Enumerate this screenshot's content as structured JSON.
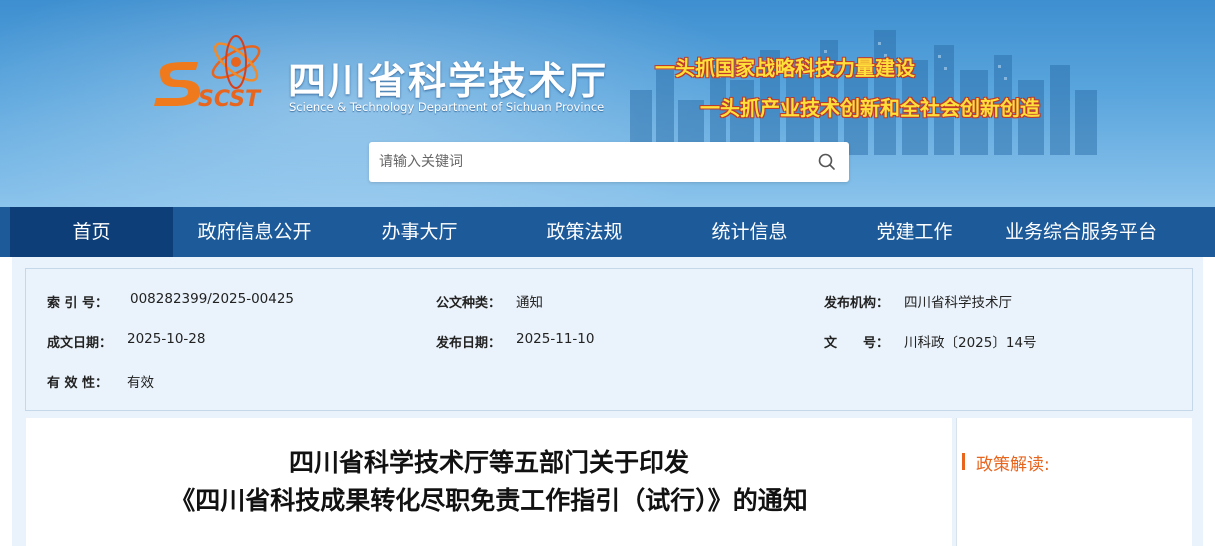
{
  "site": {
    "name": "四川省科学技术厅",
    "name_en": "Science & Technology Department of Sichuan Province",
    "logo_text": "SCST",
    "slogan_line1": "一头抓国家战略科技力量建设",
    "slogan_line2": "一头抓产业技术创新和全社会创新创造"
  },
  "search": {
    "placeholder": "请输入关键词",
    "value": ""
  },
  "nav": {
    "items": [
      {
        "label": "首页",
        "active": true
      },
      {
        "label": "政府信息公开"
      },
      {
        "label": "办事大厅"
      },
      {
        "label": "政策法规"
      },
      {
        "label": "统计信息"
      },
      {
        "label": "党建工作"
      },
      {
        "label": "业务综合服务平台"
      }
    ]
  },
  "meta": {
    "index_label": "索 引 号：",
    "index_value": "008282399/2025-00425",
    "type_label": "公文种类：",
    "type_value": "通知",
    "issuer_label": "发布机构：",
    "issuer_value": "四川省科学技术厅",
    "created_label": "成文日期：",
    "created_value": "2025-10-28",
    "published_label": "发布日期：",
    "published_value": "2025-11-10",
    "docno_label": "文　　号：",
    "docno_value": "川科政〔2025〕14号",
    "validity_label": "有 效 性：",
    "validity_value": "有效"
  },
  "article": {
    "title_line1": "四川省科学技术厅等五部门关于印发",
    "title_line2": "《四川省科技成果转化尽职免责工作指引（试行）》的通知"
  },
  "sidebar": {
    "title": "政策解读:"
  },
  "colors": {
    "nav_bg": "#1c5a9a",
    "nav_active": "#0e3e78",
    "accent": "#e8651e",
    "meta_bg": "#eaf3fb"
  }
}
